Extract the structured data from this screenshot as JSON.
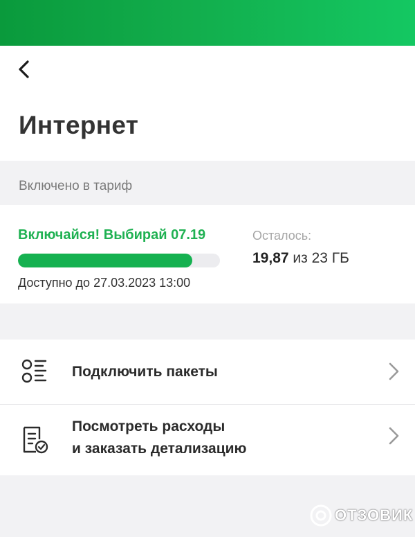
{
  "header": {
    "title": "Интернет",
    "back_icon": "chevron-left-icon"
  },
  "tariff_section": {
    "label": "Включено в тариф",
    "tariff_name": "Включайся! Выбирай 07.19",
    "available_until": "Доступно до 27.03.2023 13:00",
    "remaining_label": "Осталось:",
    "remaining_amount": "19,87",
    "remaining_total": " из 23 ГБ",
    "usage_fraction": 0.864,
    "accent_color": "#15b150"
  },
  "menu": {
    "items": [
      {
        "icon": "list-icon",
        "label": "Подключить пакеты"
      },
      {
        "icon": "document-check-icon",
        "label_line1": "Посмотреть расходы",
        "label_line2": "и заказать детализацию"
      }
    ]
  },
  "watermark": {
    "text": "ОТЗОВИК"
  }
}
